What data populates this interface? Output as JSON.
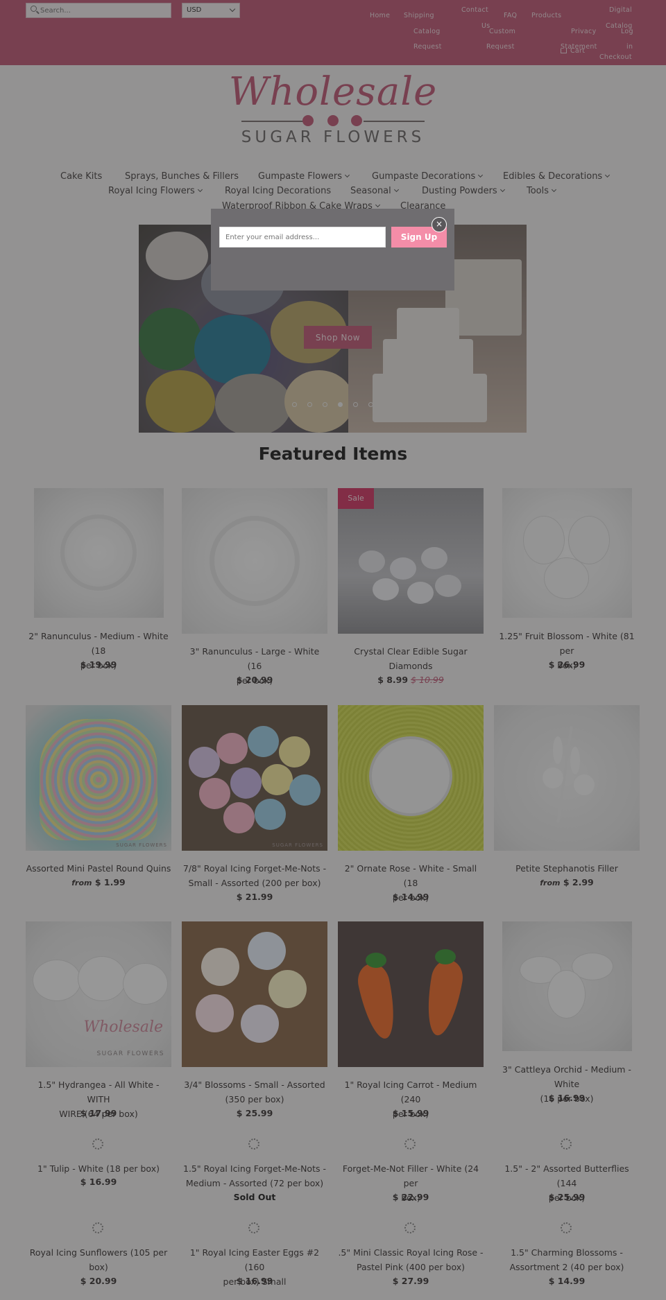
{
  "header": {
    "search_placeholder": "Search...",
    "currency": "USD",
    "links": {
      "home": "Home",
      "shipping": "Shipping",
      "contact": "Contact",
      "contact_us": "Us",
      "faq": "FAQ",
      "products": "Products",
      "digital": "Digital",
      "catalog": "Catalog",
      "catalog_request": "Request",
      "custom": "Custom",
      "custom_request": "Request",
      "privacy": "Privacy",
      "privacy_statement": "Statement",
      "digital_catalog": "Catalog",
      "log": "Log",
      "log_in": "in",
      "cart": "Cart",
      "checkout": "Checkout"
    }
  },
  "logo": {
    "script": "Wholesale",
    "subtitle": "SUGAR FLOWERS"
  },
  "nav": {
    "cake_kits": "Cake Kits",
    "sprays": "Sprays, Bunches & Fillers",
    "gumpaste_flowers": "Gumpaste Flowers",
    "gumpaste_decorations": "Gumpaste Decorations",
    "edibles": "Edibles & Decorations",
    "royal_icing_flowers": "Royal Icing Flowers",
    "royal_icing_decorations": "Royal Icing Decorations",
    "seasonal": "Seasonal",
    "dusting_powders": "Dusting Powders",
    "tools": "Tools",
    "ribbon": "Waterproof Ribbon & Cake Wraps",
    "clearance": "Clearance"
  },
  "slider": {
    "button": "Shop Now",
    "slide_count": 6,
    "active_slide": 4
  },
  "popup": {
    "email_placeholder": "Enter your email address...",
    "button": "Sign Up",
    "close": "×"
  },
  "featured_title": "Featured Items",
  "products": [
    {
      "title_1": "2\" Ranunculus - Medium - White (18",
      "title_2": "per box)",
      "price": "$ 19.99"
    },
    {
      "title_1": "3\" Ranunculus - Large - White (16",
      "title_2": "per box)",
      "price": "$ 20.99"
    },
    {
      "title_1": "Crystal Clear Edible Sugar",
      "title_2": "Diamonds",
      "price": "$ 8.99",
      "old_price": "$ 10.99",
      "badge": "Sale"
    },
    {
      "title_1": "1.25\" Fruit Blossom - White (81 per",
      "title_2": "box)",
      "price": "$ 26.99"
    },
    {
      "title_1": "Assorted Mini Pastel Round Quins",
      "from": "from",
      "price": "$ 1.99",
      "watermark": "SUGAR FLOWERS"
    },
    {
      "title_1": "7/8\" Royal Icing Forget-Me-Nots -",
      "title_2": "Small - Assorted (200 per box)",
      "price": "$ 21.99",
      "watermark": "SUGAR FLOWERS"
    },
    {
      "title_1": "2\" Ornate Rose - White - Small (18",
      "title_2": "per box)",
      "price": "$ 14.99"
    },
    {
      "title_1": "Petite Stephanotis Filler",
      "from": "from",
      "price": "$ 2.99"
    },
    {
      "title_1": "1.5\" Hydrangea - All White - WITH",
      "title_2": "WIRE (64 per box)",
      "price": "$ 17.99",
      "watermark_script": "Wholesale",
      "watermark": "SUGAR FLOWERS"
    },
    {
      "title_1": "3/4\" Blossoms - Small - Assorted",
      "title_2": "(350 per box)",
      "price": "$ 25.99"
    },
    {
      "title_1": "1\" Royal Icing Carrot - Medium (240",
      "title_2": "per box)",
      "price": "$ 15.99"
    },
    {
      "title_1": "3\" Cattleya Orchid - Medium - White",
      "title_2": "(16 per box)",
      "price": "$ 16.99"
    },
    {
      "title_1": "1\" Tulip - White (18 per box)",
      "price": "$ 16.99"
    },
    {
      "title_1": "1.5\" Royal Icing Forget-Me-Nots -",
      "title_2": "Medium - Assorted (72 per box)",
      "status": "Sold Out"
    },
    {
      "title_1": "Forget-Me-Not Filler - White (24 per",
      "title_2": "box)",
      "price": "$ 22.99"
    },
    {
      "title_1": "1.5\" - 2\" Assorted Butterflies (144",
      "title_2": "per box)",
      "price": "$ 25.99"
    },
    {
      "title_1": "Royal Icing Sunflowers (105 per",
      "title_2": "box)",
      "price": "$ 20.99"
    },
    {
      "title_1": "1\" Royal Icing Easter Eggs #2 (160",
      "title_2": "per box) Small",
      "price": "$ 16.99"
    },
    {
      "title_1": ".5\" Mini Classic Royal Icing Rose -",
      "title_2": "Pastel Pink (400 per box)",
      "price": "$ 27.99"
    },
    {
      "title_1": "1.5\" Charming Blossoms -",
      "title_2": "Assortment 2 (40 per box)",
      "price": "$ 14.99"
    }
  ],
  "colors": {
    "brand": "#c15c78",
    "sale": "#d43a66",
    "signup": "#f48da8"
  }
}
